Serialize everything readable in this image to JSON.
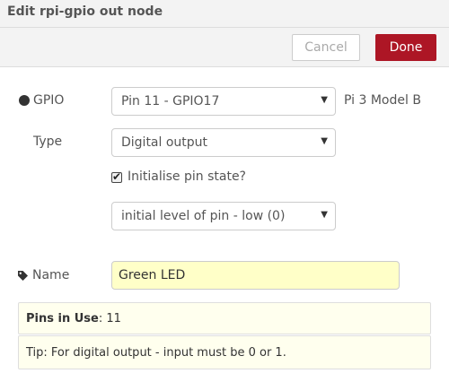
{
  "dialog": {
    "title": "Edit rpi-gpio out node",
    "cancel_label": "Cancel",
    "done_label": "Done"
  },
  "form": {
    "gpio": {
      "label": "GPIO",
      "selected": "Pin 11 - GPIO17",
      "board_model": "Pi 3 Model B"
    },
    "type": {
      "label": "Type",
      "selected": "Digital output"
    },
    "initialise": {
      "label": "Initialise pin state?",
      "checked": true
    },
    "initial_level": {
      "selected": "initial level of pin - low (0)"
    },
    "name": {
      "label": "Name",
      "value": "Green LED"
    }
  },
  "info": {
    "pins_label": "Pins in Use",
    "pins_value": ": 11",
    "tip": "Tip: For digital output - input must be 0 or 1."
  },
  "icons": {
    "gpio": "filled-circle-icon",
    "name": "tag-icon",
    "dropdown": "caret-down-icon",
    "checkbox": "checkmark-icon"
  },
  "colors": {
    "done_button": "#ad1625",
    "name_field_bg": "#ffffc8",
    "info_bg": "#ffffee"
  }
}
